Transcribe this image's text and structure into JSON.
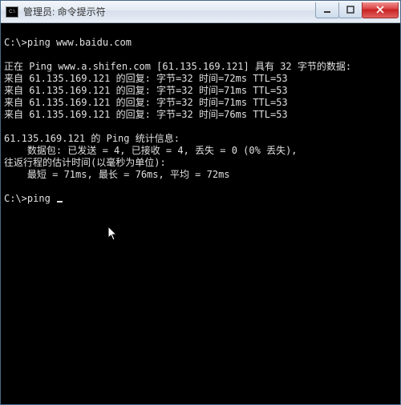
{
  "window": {
    "title": "管理员: 命令提示符",
    "icon_label": "C:\\"
  },
  "terminal": {
    "prompt1": "C:\\>",
    "cmd1": "ping www.baidu.com",
    "blank1": "",
    "ping_header": "正在 Ping www.a.shifen.com [61.135.169.121] 具有 32 字节的数据:",
    "reply1": "来自 61.135.169.121 的回复: 字节=32 时间=72ms TTL=53",
    "reply2": "来自 61.135.169.121 的回复: 字节=32 时间=71ms TTL=53",
    "reply3": "来自 61.135.169.121 的回复: 字节=32 时间=71ms TTL=53",
    "reply4": "来自 61.135.169.121 的回复: 字节=32 时间=76ms TTL=53",
    "blank2": "",
    "stats_header": "61.135.169.121 的 Ping 统计信息:",
    "stats_packets": "    数据包: 已发送 = 4, 已接收 = 4, 丢失 = 0 (0% 丢失),",
    "rtt_header": "往返行程的估计时间(以毫秒为单位):",
    "rtt_values": "    最短 = 71ms, 最长 = 76ms, 平均 = 72ms",
    "blank3": "",
    "prompt2": "C:\\>",
    "cmd2": "ping "
  }
}
